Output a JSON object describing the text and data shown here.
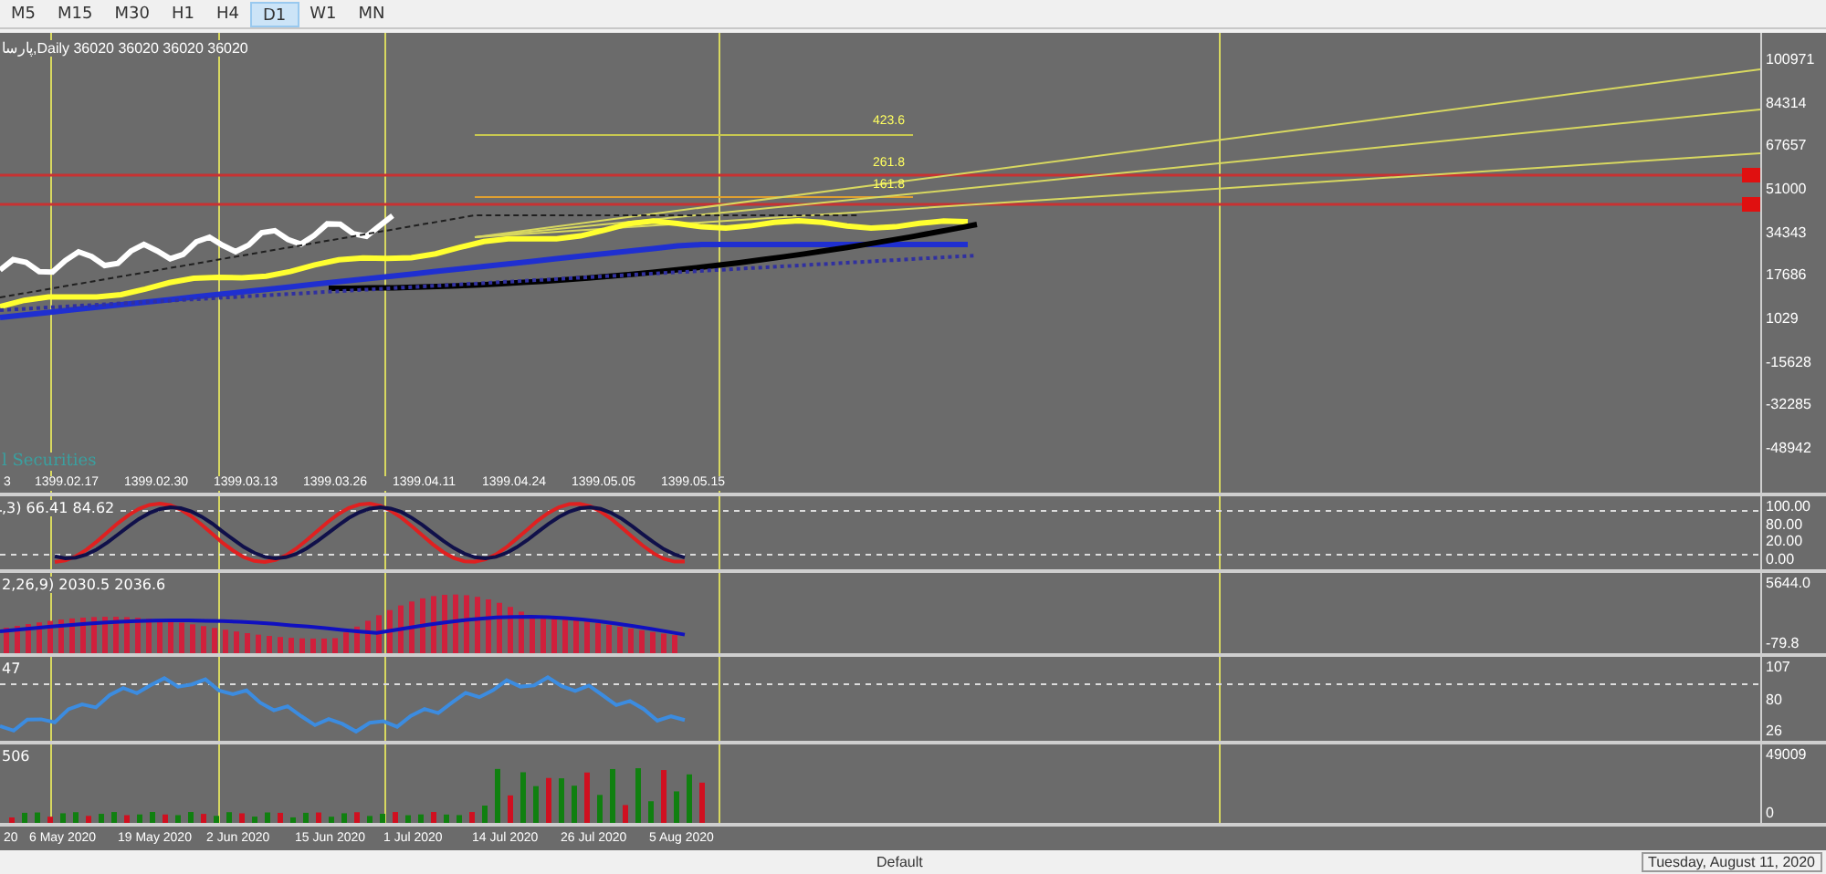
{
  "timeframes": [
    {
      "label": "M5",
      "selected": false
    },
    {
      "label": "M15",
      "selected": false
    },
    {
      "label": "M30",
      "selected": false
    },
    {
      "label": "H1",
      "selected": false
    },
    {
      "label": "H4",
      "selected": false
    },
    {
      "label": "D1",
      "selected": true
    },
    {
      "label": "W1",
      "selected": false
    },
    {
      "label": "MN",
      "selected": false
    }
  ],
  "main_chart": {
    "title": "پارسا,Daily  36020 36020 36020 36020",
    "fib_levels": [
      "423.6",
      "261.8",
      "161.8"
    ],
    "price_axis": [
      "100971",
      "84314",
      "67657",
      "51000",
      "34343",
      "17686",
      "1029",
      "-15628",
      "-32285",
      "-48942"
    ],
    "indicator_name": "l Securities",
    "top_dates": [
      "3",
      "1399.02.17",
      "1399.02.30",
      "1399.03.13",
      "1399.03.26",
      "1399.04.11",
      "1399.04.24",
      "1399.05.05",
      "1399.05.15"
    ]
  },
  "stochastic": {
    "label": ",3) 66.41 84.62",
    "axis": [
      "100.00",
      "80.00",
      "20.00",
      "0.00"
    ]
  },
  "macd": {
    "label": "2,26,9) 2030.5 2036.6",
    "axis": [
      "5644.0",
      "-79.8"
    ]
  },
  "oscillator": {
    "label": "47",
    "axis": [
      "107",
      "80",
      "26"
    ]
  },
  "volume": {
    "label": "506",
    "axis": [
      "49009",
      "0"
    ]
  },
  "date_axis": [
    "20",
    "6 May 2020",
    "19 May 2020",
    "2 Jun 2020",
    "15 Jun 2020",
    "1 Jul 2020",
    "14 Jul 2020",
    "26 Jul 2020",
    "5 Aug 2020"
  ],
  "status_bar": {
    "profile": "Default",
    "date": "Tuesday, August 11, 2020"
  }
}
